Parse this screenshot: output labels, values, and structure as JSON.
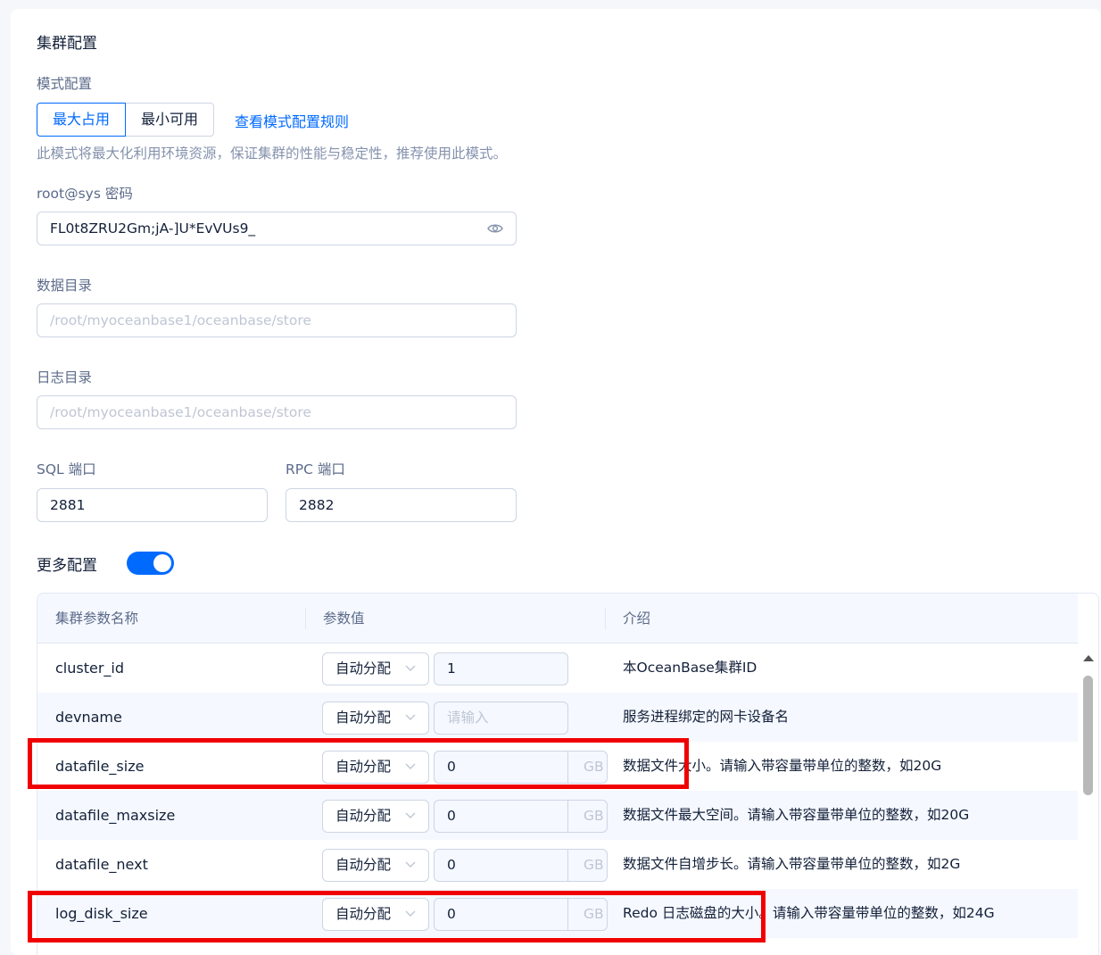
{
  "page": {
    "title": "集群配置",
    "mode_label": "模式配置",
    "mode_options": [
      "最大占用",
      "最小可用"
    ],
    "mode_rules_link": "查看模式配置规则",
    "mode_desc": "此模式将最大化利用环境资源，保证集群的性能与稳定性，推荐使用此模式。",
    "password_label": "root@sys 密码",
    "password_value": "FL0t8ZRU2Gm;jA-]U*EvVUs9_",
    "data_dir_label": "数据目录",
    "data_dir_placeholder": "/root/myoceanbase1/oceanbase/store",
    "log_dir_label": "日志目录",
    "log_dir_placeholder": "/root/myoceanbase1/oceanbase/store",
    "sql_port_label": "SQL 端口",
    "sql_port_value": "2881",
    "rpc_port_label": "RPC 端口",
    "rpc_port_value": "2882",
    "more_config_label": "更多配置",
    "more_config_enabled": true
  },
  "table": {
    "columns": [
      "集群参数名称",
      "参数值",
      "介绍"
    ],
    "rows": [
      {
        "name": "cluster_id",
        "mode": "自动分配",
        "value": "1",
        "placeholder": "",
        "unit": "",
        "desc": "本OceanBase集群ID"
      },
      {
        "name": "devname",
        "mode": "自动分配",
        "value": "",
        "placeholder": "请输入",
        "unit": "",
        "desc": "服务进程绑定的网卡设备名"
      },
      {
        "name": "datafile_size",
        "mode": "自动分配",
        "value": "0",
        "placeholder": "",
        "unit": "GB",
        "desc": "数据文件大小。请输入带容量带单位的整数，如20G"
      },
      {
        "name": "datafile_maxsize",
        "mode": "自动分配",
        "value": "0",
        "placeholder": "",
        "unit": "GB",
        "desc": "数据文件最大空间。请输入带容量带单位的整数，如20G"
      },
      {
        "name": "datafile_next",
        "mode": "自动分配",
        "value": "0",
        "placeholder": "",
        "unit": "GB",
        "desc": "数据文件自增步长。请输入带容量带单位的整数，如2G"
      },
      {
        "name": "log_disk_size",
        "mode": "自动分配",
        "value": "0",
        "placeholder": "",
        "unit": "GB",
        "desc": "Redo 日志磁盘的大小。请输入带容量带单位的整数，如24G"
      }
    ]
  },
  "colors": {
    "accent": "#006aff",
    "highlight": "#f00000"
  },
  "icons": [
    "eye-icon",
    "chevron-down-icon",
    "scroll-up-arrow-icon"
  ]
}
